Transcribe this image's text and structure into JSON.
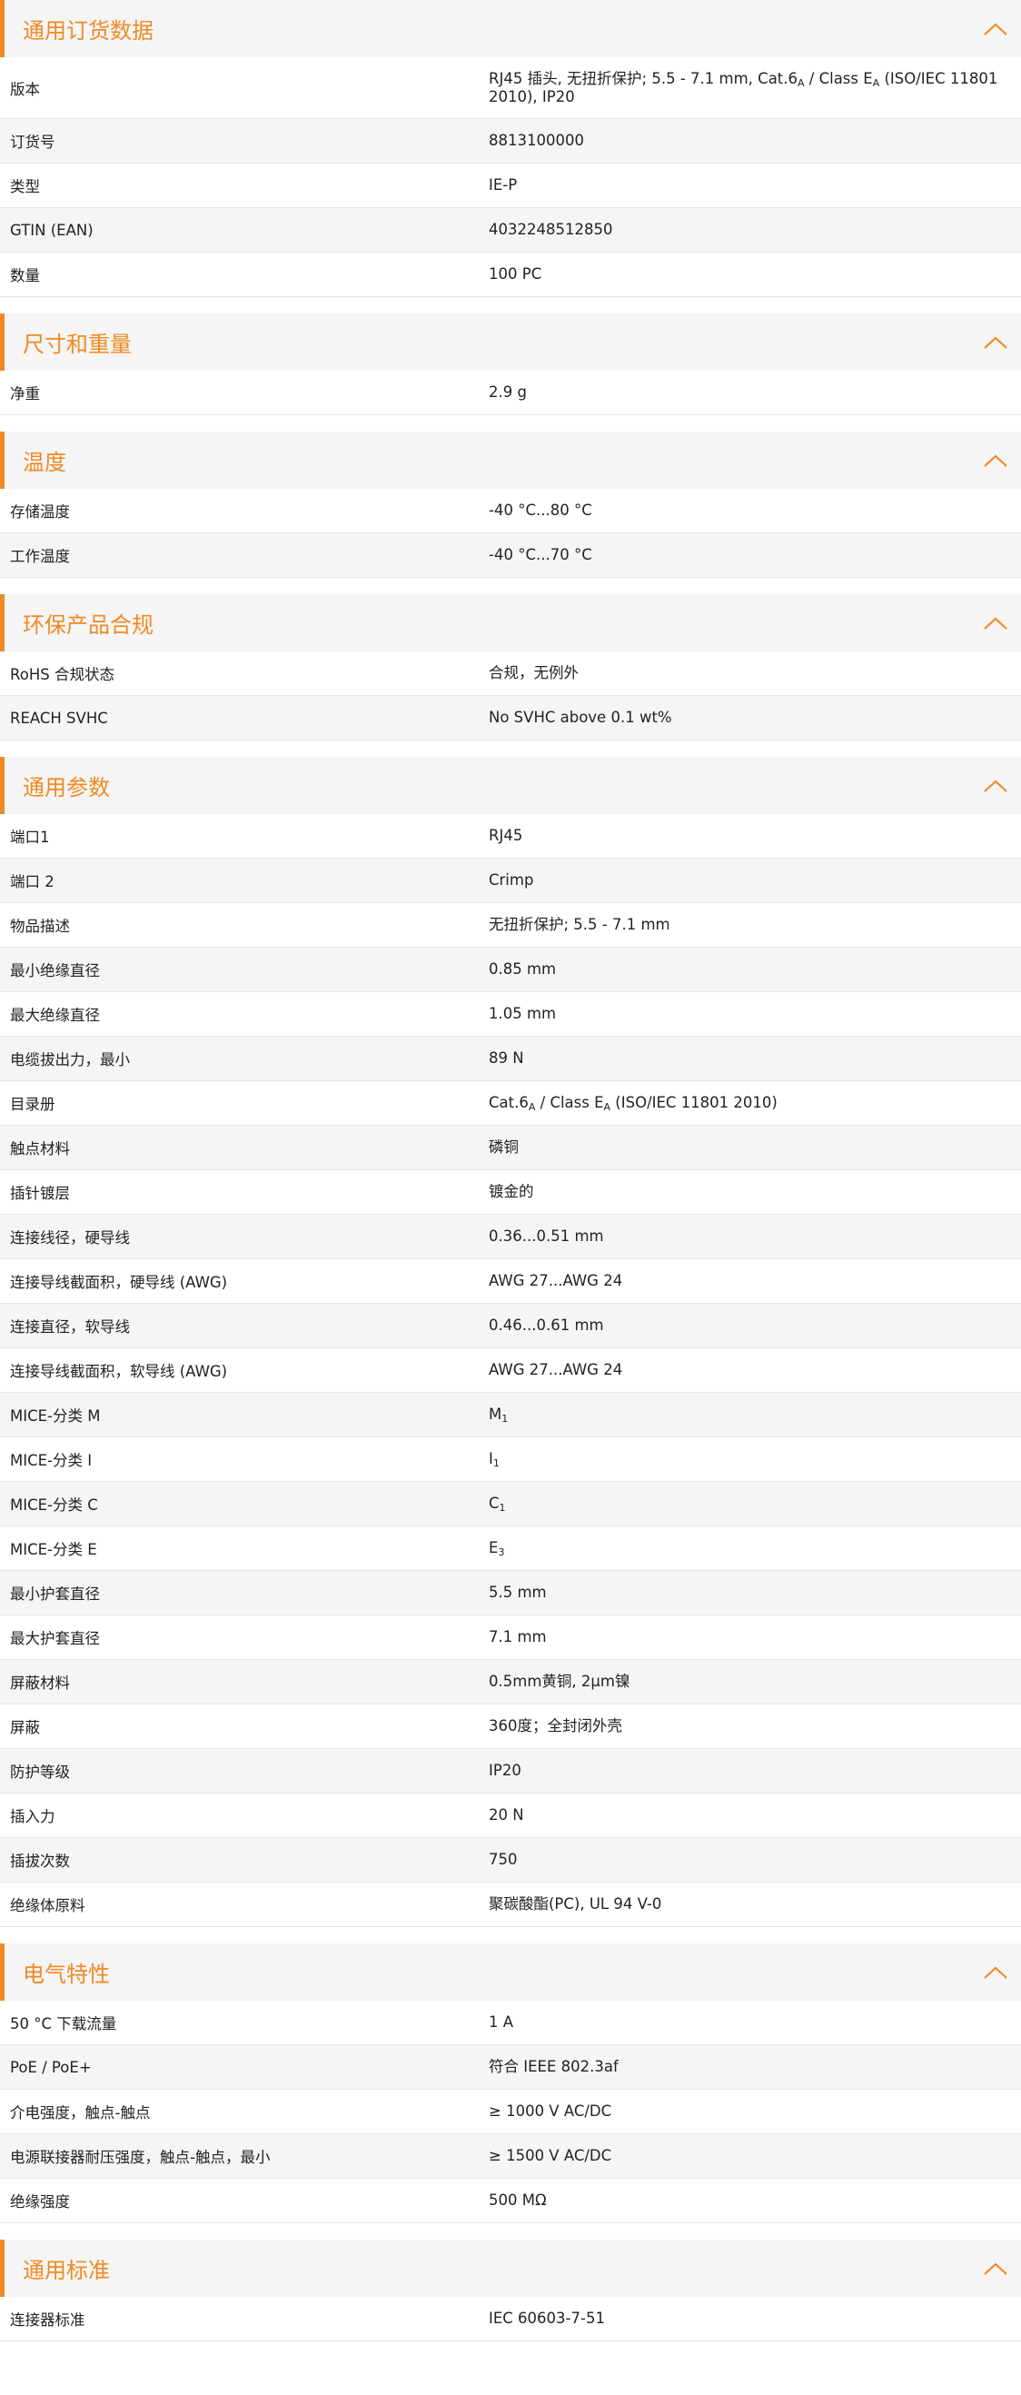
{
  "accent_color": "#f08a24",
  "chevron_icon": "chevron-up-icon",
  "sections": [
    {
      "title": "通用订货数据",
      "rows": [
        {
          "k": "版本",
          "parts": [
            {
              "t": "RJ45 插头, 无扭折保护; 5.5 - 7.1 mm, Cat.6"
            },
            {
              "t": "A",
              "sub": true
            },
            {
              "t": " / Class E"
            },
            {
              "t": "A",
              "sub": true
            },
            {
              "t": " (ISO/IEC 11801 2010), IP20"
            }
          ],
          "h": 68
        },
        {
          "k": "订货号",
          "v": "8813100000",
          "h": 49
        },
        {
          "k": "类型",
          "v": "IE-P",
          "h": 49
        },
        {
          "k": "GTIN (EAN)",
          "v": "4032248512850",
          "h": 49
        },
        {
          "k": "数量",
          "v": "100  PC",
          "h": 49
        }
      ]
    },
    {
      "title": "尺寸和重量",
      "rows": [
        {
          "k": "净重",
          "v": "2.9  g",
          "h": 49
        }
      ]
    },
    {
      "title": "温度",
      "rows": [
        {
          "k": "存储温度",
          "v": "-40 °C...80 °C",
          "h": 49
        },
        {
          "k": "工作温度",
          "v": "-40 °C...70 °C",
          "h": 49
        }
      ]
    },
    {
      "title": "环保产品合规",
      "rows": [
        {
          "k": "RoHS 合规状态",
          "v": "合规，无例外",
          "h": 49
        },
        {
          "k": "REACH SVHC",
          "v": "No SVHC above 0.1 wt%",
          "h": 49
        }
      ]
    },
    {
      "title": "通用参数",
      "rows": [
        {
          "k": "端口1",
          "v": "RJ45",
          "h": 49
        },
        {
          "k": "端口 2",
          "v": "Crimp",
          "h": 49
        },
        {
          "k": "物品描述",
          "v": "无扭折保护; 5.5 - 7.1 mm",
          "h": 49
        },
        {
          "k": "最小绝缘直径",
          "v": "0.85  mm",
          "h": 49
        },
        {
          "k": "最大绝缘直径",
          "v": "1.05  mm",
          "h": 49
        },
        {
          "k": "电缆拔出力，最小",
          "v": "89  N",
          "h": 49
        },
        {
          "k": "目录册",
          "parts": [
            {
              "t": "Cat.6"
            },
            {
              "t": "A",
              "sub": true
            },
            {
              "t": " / Class E"
            },
            {
              "t": "A",
              "sub": true
            },
            {
              "t": " (ISO/IEC 11801 2010)"
            }
          ],
          "h": 49
        },
        {
          "k": "触点材料",
          "v": "磷铜",
          "h": 49
        },
        {
          "k": "插针镀层",
          "v": "镀金的",
          "h": 49
        },
        {
          "k": "连接线径，硬导线",
          "v": "0.36...0.51 mm",
          "h": 49
        },
        {
          "k": "连接导线截面积，硬导线 (AWG)",
          "v": "AWG 27...AWG 24",
          "h": 49
        },
        {
          "k": "连接直径，软导线",
          "v": "0.46...0.61 mm",
          "h": 49
        },
        {
          "k": "连接导线截面积，软导线 (AWG)",
          "v": "AWG 27...AWG 24",
          "h": 49
        },
        {
          "k": "MICE-分类 M",
          "parts": [
            {
              "t": "M"
            },
            {
              "t": "1",
              "sub": true
            }
          ],
          "h": 49
        },
        {
          "k": "MICE-分类 I",
          "parts": [
            {
              "t": "I"
            },
            {
              "t": "1",
              "sub": true
            }
          ],
          "h": 49
        },
        {
          "k": "MICE-分类 C",
          "parts": [
            {
              "t": "C"
            },
            {
              "t": "1",
              "sub": true
            }
          ],
          "h": 49
        },
        {
          "k": "MICE-分类 E",
          "parts": [
            {
              "t": "E"
            },
            {
              "t": "3",
              "sub": true
            }
          ],
          "h": 49
        },
        {
          "k": "最小护套直径",
          "v": "5.5  mm",
          "h": 49
        },
        {
          "k": "最大护套直径",
          "v": "7.1  mm",
          "h": 49
        },
        {
          "k": "屏蔽材料",
          "v": "0.5mm黄铜, 2μm镍",
          "h": 49
        },
        {
          "k": "屏蔽",
          "v": "360度；全封闭外壳",
          "h": 49
        },
        {
          "k": "防护等级",
          "v": "IP20",
          "h": 49
        },
        {
          "k": "插入力",
          "v": "20 N",
          "h": 49
        },
        {
          "k": "插拔次数",
          "v": "750",
          "h": 49
        },
        {
          "k": "绝缘体原料",
          "v": "聚碳酸酯(PC), UL 94 V-0",
          "h": 49
        }
      ]
    },
    {
      "title": "电气特性",
      "rows": [
        {
          "k": "50 °C 下载流量",
          "v": "1  A",
          "h": 49
        },
        {
          "k": "PoE / PoE+",
          "v": "符合 IEEE 802.3af",
          "h": 49
        },
        {
          "k": "介电强度，触点-触点",
          "v": "≥ 1000 V AC/DC",
          "h": 49
        },
        {
          "k": "电源联接器耐压强度，触点-触点，最小",
          "v": "≥ 1500 V AC/DC",
          "h": 49
        },
        {
          "k": "绝缘强度",
          "v": "500 MΩ",
          "h": 49
        }
      ]
    },
    {
      "title": "通用标准",
      "rows": [
        {
          "k": "连接器标准",
          "v": "IEC 60603-7-51",
          "h": 49
        }
      ]
    }
  ]
}
